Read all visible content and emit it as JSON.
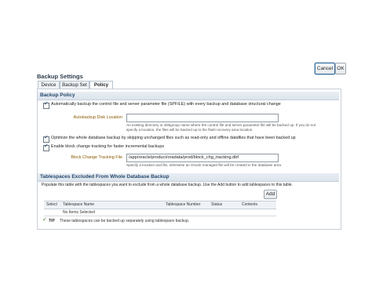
{
  "buttons": {
    "cancel": "Cancel",
    "ok": "OK",
    "add": "Add"
  },
  "page_title": "Backup Settings",
  "tabs": [
    {
      "label": "Device",
      "active": false
    },
    {
      "label": "Backup Set",
      "active": false
    },
    {
      "label": "Policy",
      "active": true
    }
  ],
  "policy": {
    "header": "Backup Policy",
    "autobackup_text": "Automatically backup the control file and server parameter file (SPFILE) with every backup and database structural change",
    "autobackup_checked": true,
    "disk_location_label": "Autobackup Disk Location",
    "disk_location_value": "",
    "disk_location_hint_1": "An existing directory or diskgroup name where the control file and server parameter file will be backed up. If you do not",
    "disk_location_hint_2": "specify a location, the files will be backed up to the flash recovery area location.",
    "optimize_text": "Optimize the whole database backup by skipping unchanged files such as read-only and offline datafiles that have been backed up",
    "optimize_checked": true,
    "block_change_text": "Enable block change tracking for faster incremental backups",
    "block_change_checked": true,
    "tracking_file_label": "Block Change Tracking File",
    "tracking_file_value": "/app/oracle/product/oradata/prod/block_chg_tracking.dbf",
    "tracking_file_hint": "Specify a location and file, otherwise an Oracle managed file will be created in the database area."
  },
  "excluded": {
    "header": "Tablespaces Excluded From Whole Database Backup",
    "description": "Populate this table with the tablespaces you want to exclude from a whole database backup. Use the Add button to add tablespaces to this table.",
    "columns": [
      "Select",
      "Tablespace Name",
      "Tablespace Number",
      "Status",
      "Contents"
    ],
    "empty_text": "No Items Selected",
    "tip_label": "TIP",
    "tip_text": "These tablespaces can be backed up separately using tablespace backup."
  }
}
